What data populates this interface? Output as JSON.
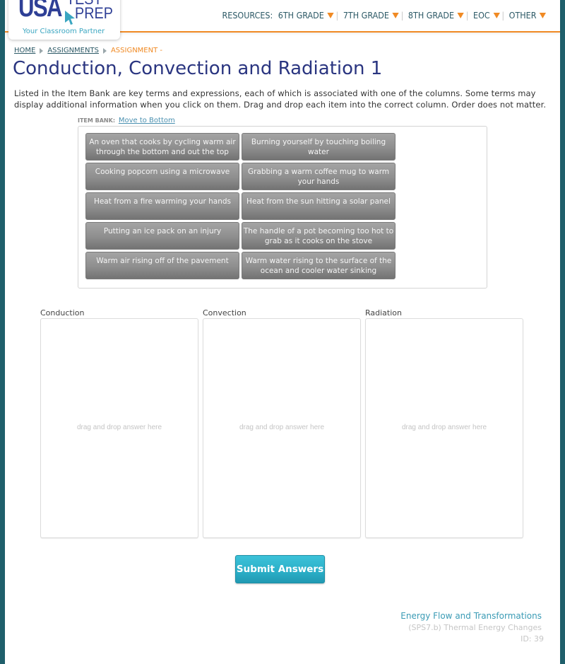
{
  "brand": {
    "logo_usa": "USA",
    "logo_test": "TEST",
    "logo_prep": "PREP",
    "tagline": "Your Classroom Partner",
    "accent_color": "#f08a24",
    "primary_color": "#2a3580",
    "teal_color": "#1f5f6b"
  },
  "nav": {
    "resources_label": "RESOURCES:",
    "items": [
      {
        "label": "6TH GRADE",
        "icon": "dropdown-triangle-icon"
      },
      {
        "label": "7TH GRADE",
        "icon": "dropdown-triangle-icon"
      },
      {
        "label": "8TH GRADE",
        "icon": "dropdown-triangle-icon"
      },
      {
        "label": "EOC",
        "icon": "dropdown-triangle-icon"
      },
      {
        "label": "OTHER",
        "icon": "dropdown-triangle-icon"
      }
    ]
  },
  "breadcrumb": {
    "items": [
      "HOME",
      "ASSIGNMENTS"
    ],
    "current": "ASSIGNMENT -"
  },
  "page": {
    "title": "Conduction, Convection and Radiation 1",
    "instructions": "Listed in the Item Bank are key terms and expressions, each of which is associated with one of the columns. Some terms may display additional information when you click on them. Drag and drop each item into the correct column. Order does not matter."
  },
  "item_bank": {
    "label": "ITEM BANK:",
    "move_link": "Move to Bottom",
    "items": [
      "An oven that cooks by cycling warm air through the bottom and out the top",
      "Burning yourself by touching boiling water",
      "Cooking popcorn using a microwave",
      "Grabbing a warm coffee mug to warm your hands",
      "Heat from a fire warming your hands",
      "Heat from the sun hitting a solar panel",
      "Putting an ice pack on an injury",
      "The handle of a pot becoming too hot to grab as it cooks on the stove",
      "Warm air rising off of the pavement",
      "Warm water rising to the surface of the ocean and cooler water sinking"
    ]
  },
  "columns": [
    {
      "label": "Conduction",
      "placeholder": "drag and drop answer here"
    },
    {
      "label": "Convection",
      "placeholder": "drag and drop answer here"
    },
    {
      "label": "Radiation",
      "placeholder": "drag and drop answer here"
    }
  ],
  "actions": {
    "submit_label": "Submit Answers"
  },
  "footer": {
    "topic": "Energy Flow and Transformations",
    "standard": "(SPS7.b) Thermal Energy Changes",
    "id": "ID: 39"
  }
}
